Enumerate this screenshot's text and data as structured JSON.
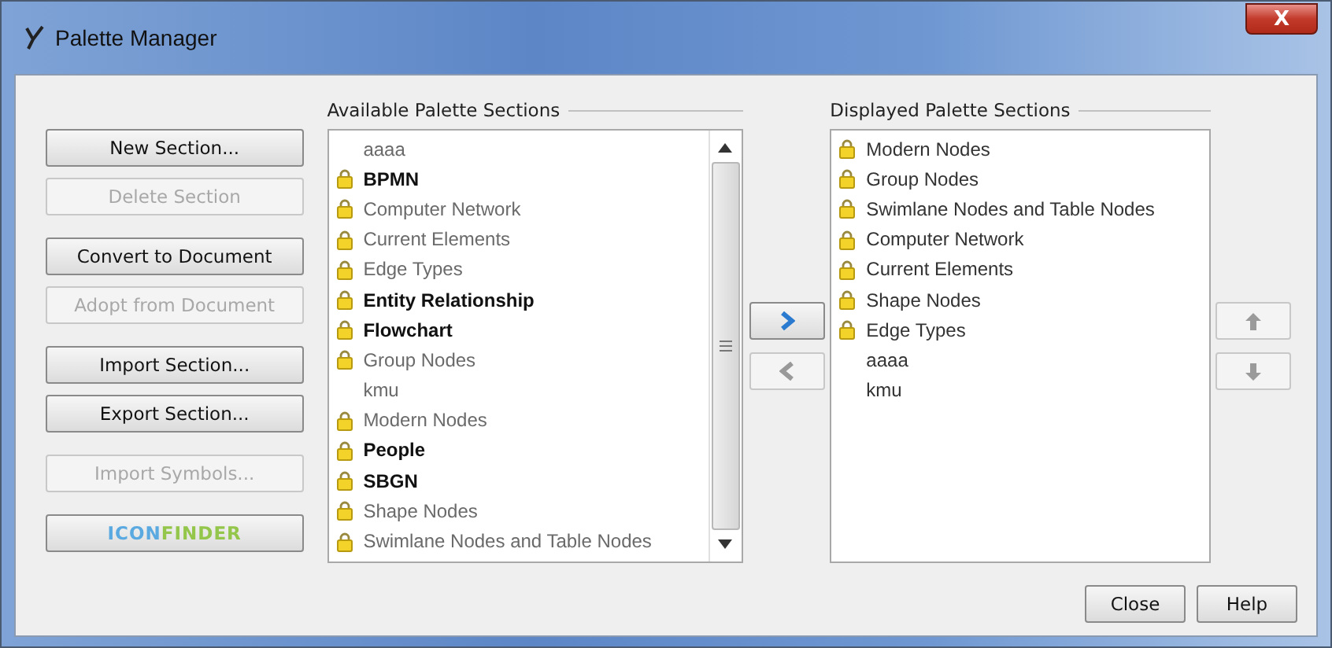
{
  "window": {
    "title": "Palette Manager",
    "close_label": "X"
  },
  "left_buttons": [
    {
      "label": "New Section...",
      "disabled": false
    },
    {
      "label": "Delete Section",
      "disabled": true
    },
    {
      "label": "Convert to Document",
      "disabled": false
    },
    {
      "label": "Adopt from Document",
      "disabled": true
    },
    {
      "label": "Import Section...",
      "disabled": false
    },
    {
      "label": "Export Section...",
      "disabled": false
    },
    {
      "label": "Import Symbols...",
      "disabled": true
    }
  ],
  "logo_button": {
    "parts": [
      {
        "text": "ICON",
        "color": "#5aa9e0"
      },
      {
        "text": "FINDER",
        "color": "#93c64a"
      }
    ]
  },
  "available": {
    "title": "Available Palette Sections",
    "items": [
      {
        "label": "aaaa",
        "locked": false,
        "dimmed": true
      },
      {
        "label": "BPMN",
        "locked": true,
        "dimmed": false
      },
      {
        "label": "Computer Network",
        "locked": true,
        "dimmed": true
      },
      {
        "label": "Current Elements",
        "locked": true,
        "dimmed": true
      },
      {
        "label": "Edge Types",
        "locked": true,
        "dimmed": true
      },
      {
        "label": "Entity Relationship",
        "locked": true,
        "dimmed": false
      },
      {
        "label": "Flowchart",
        "locked": true,
        "dimmed": false
      },
      {
        "label": "Group Nodes",
        "locked": true,
        "dimmed": true
      },
      {
        "label": "kmu",
        "locked": false,
        "dimmed": true
      },
      {
        "label": "Modern Nodes",
        "locked": true,
        "dimmed": true
      },
      {
        "label": "People",
        "locked": true,
        "dimmed": false
      },
      {
        "label": "SBGN",
        "locked": true,
        "dimmed": false
      },
      {
        "label": "Shape Nodes",
        "locked": true,
        "dimmed": true
      },
      {
        "label": "Swimlane Nodes and Table Nodes",
        "locked": true,
        "dimmed": true
      }
    ]
  },
  "transfer_buttons": [
    {
      "kind": "add",
      "disabled": false
    },
    {
      "kind": "remove",
      "disabled": true
    }
  ],
  "displayed": {
    "title": "Displayed Palette Sections",
    "items": [
      {
        "label": "Modern Nodes",
        "locked": true
      },
      {
        "label": "Group Nodes",
        "locked": true
      },
      {
        "label": "Swimlane Nodes and Table Nodes",
        "locked": true
      },
      {
        "label": "Computer Network",
        "locked": true
      },
      {
        "label": "Current Elements",
        "locked": true
      },
      {
        "label": "Shape Nodes",
        "locked": true
      },
      {
        "label": "Edge Types",
        "locked": true
      },
      {
        "label": "aaaa",
        "locked": false
      },
      {
        "label": "kmu",
        "locked": false
      }
    ]
  },
  "order_buttons": [
    {
      "kind": "up",
      "disabled": true
    },
    {
      "kind": "down",
      "disabled": true
    }
  ],
  "footer_buttons": [
    {
      "label": "Close"
    },
    {
      "label": "Help"
    }
  ]
}
